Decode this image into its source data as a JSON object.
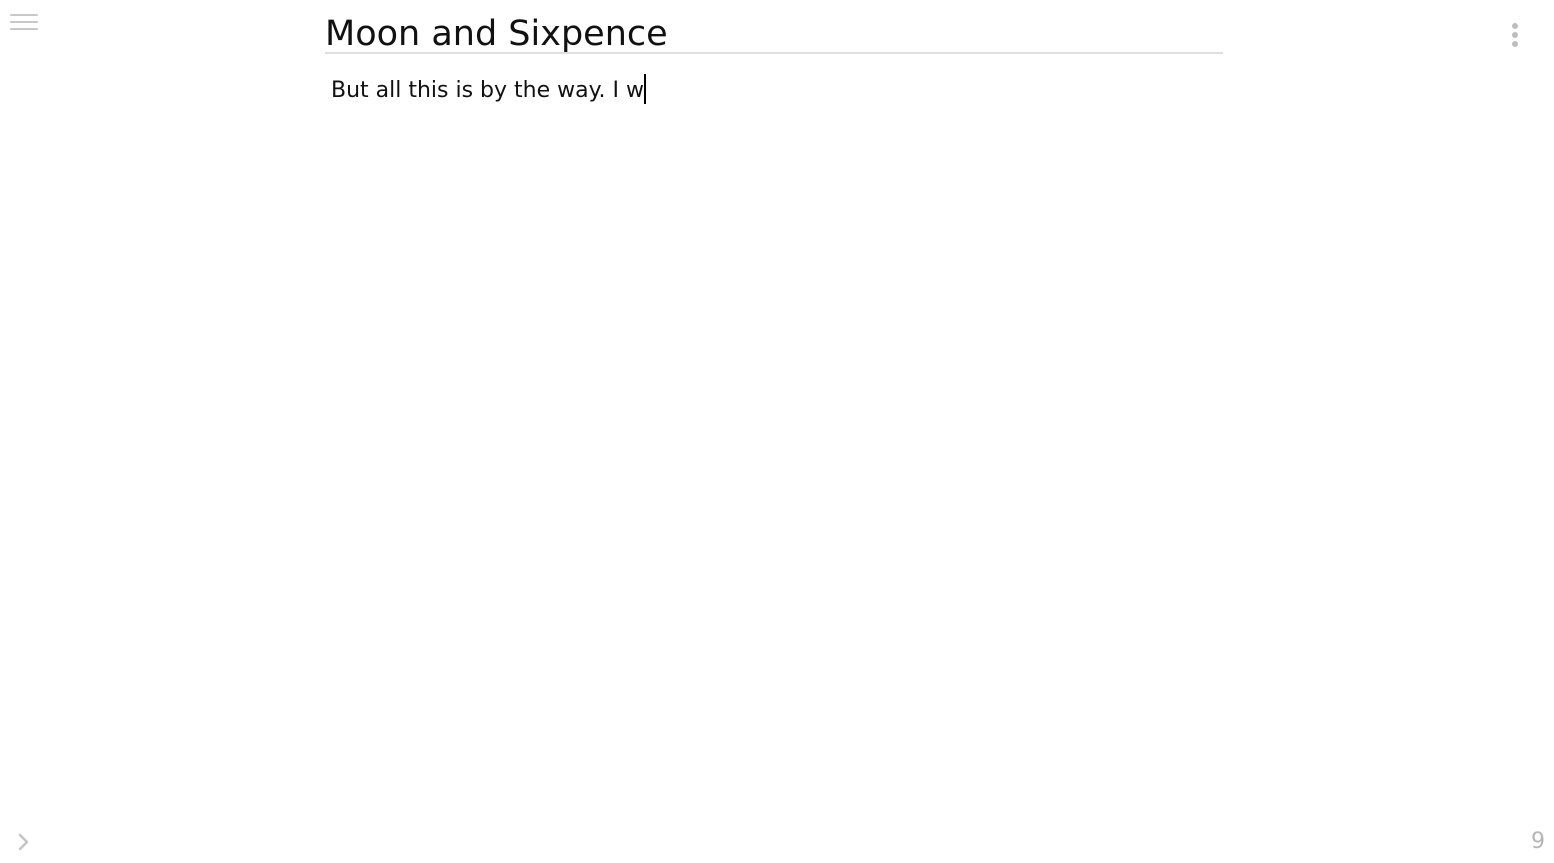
{
  "toolbar": {
    "menu_icon": "hamburger-menu-icon",
    "more_icon": "more-vertical-icon"
  },
  "document": {
    "title": "Moon and Sixpence",
    "body": "But all this is by the way. I w"
  },
  "footer": {
    "expand_icon": "chevron-right-icon",
    "word_count": "9"
  }
}
